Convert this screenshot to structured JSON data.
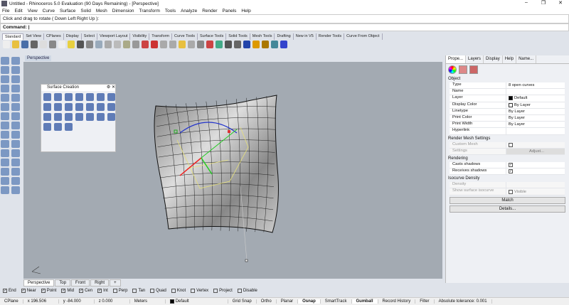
{
  "window": {
    "title": "Untitled - Rhinoceros 5.0 Evaluation (90 Days Remaining) - [Perspective]",
    "minimize": "–",
    "maximize": "❐",
    "close": "✕"
  },
  "menu": [
    "File",
    "Edit",
    "View",
    "Curve",
    "Surface",
    "Solid",
    "Mesh",
    "Dimension",
    "Transform",
    "Tools",
    "Analyze",
    "Render",
    "Panels",
    "Help"
  ],
  "command": {
    "history": "Click and drag to rotate ( Down  Left  Right  Up ):",
    "prompt": "Command:"
  },
  "toolbar_tabs": [
    "Standard",
    "Set View",
    "CPlanes",
    "Display",
    "Select",
    "Viewport Layout",
    "Visibility",
    "Transform",
    "Curve Tools",
    "Surface Tools",
    "Solid Tools",
    "Mesh Tools",
    "Drafting",
    "New in V5",
    "Render Tools",
    "Curve From Object"
  ],
  "viewport": {
    "label": "Perspective",
    "tabs": [
      "Perspective",
      "Top",
      "Front",
      "Right",
      "+"
    ]
  },
  "surface_panel": {
    "title": "Surface Creation"
  },
  "properties": {
    "tabs": [
      "Prope...",
      "Layers",
      "Display",
      "Help",
      "Name..."
    ],
    "object_section": "Object",
    "rows": [
      {
        "k": "Type",
        "v": "8 open curves"
      },
      {
        "k": "Name",
        "v": ""
      },
      {
        "k": "Layer",
        "v": "Default"
      },
      {
        "k": "Display Color",
        "v": "By Layer"
      },
      {
        "k": "Linetype",
        "v": "By Layer"
      },
      {
        "k": "Print Color",
        "v": "By Layer"
      },
      {
        "k": "Print Width",
        "v": "By Layer"
      },
      {
        "k": "Hyperlink",
        "v": ""
      }
    ],
    "render_mesh_section": "Render Mesh Settings",
    "custom_mesh": "Custom Mesh",
    "settings": "Settings",
    "adjust": "Adjust...",
    "rendering_section": "Rendering",
    "casts_shadows": "Casts shadows",
    "receives_shadows": "Receives shadows",
    "isocurve_section": "Isocurve Density",
    "density": "Density",
    "show_iso": "Show surface isocurve",
    "visible": "Visible",
    "match": "Match",
    "details": "Details..."
  },
  "osnap": [
    {
      "label": "End",
      "checked": true
    },
    {
      "label": "Near",
      "checked": true
    },
    {
      "label": "Point",
      "checked": true
    },
    {
      "label": "Mid",
      "checked": true
    },
    {
      "label": "Cen",
      "checked": true
    },
    {
      "label": "Int",
      "checked": true
    },
    {
      "label": "Perp",
      "checked": false
    },
    {
      "label": "Tan",
      "checked": false
    },
    {
      "label": "Quad",
      "checked": false
    },
    {
      "label": "Knot",
      "checked": false
    },
    {
      "label": "Vertex",
      "checked": false
    },
    {
      "label": "Project",
      "checked": false
    },
    {
      "label": "Disable",
      "checked": false
    }
  ],
  "status": {
    "cplane": "CPlane",
    "x": "x 196.506",
    "y": "y -84.000",
    "z": "z 0.000",
    "units": "Meters",
    "layer": "Default",
    "grid_snap": "Grid Snap",
    "ortho": "Ortho",
    "planar": "Planar",
    "osnap": "Osnap",
    "smarttrack": "SmartTrack",
    "gumball": "Gumball",
    "record_history": "Record History",
    "filter": "Filter",
    "tolerance": "Absolute tolerance: 0.001"
  }
}
